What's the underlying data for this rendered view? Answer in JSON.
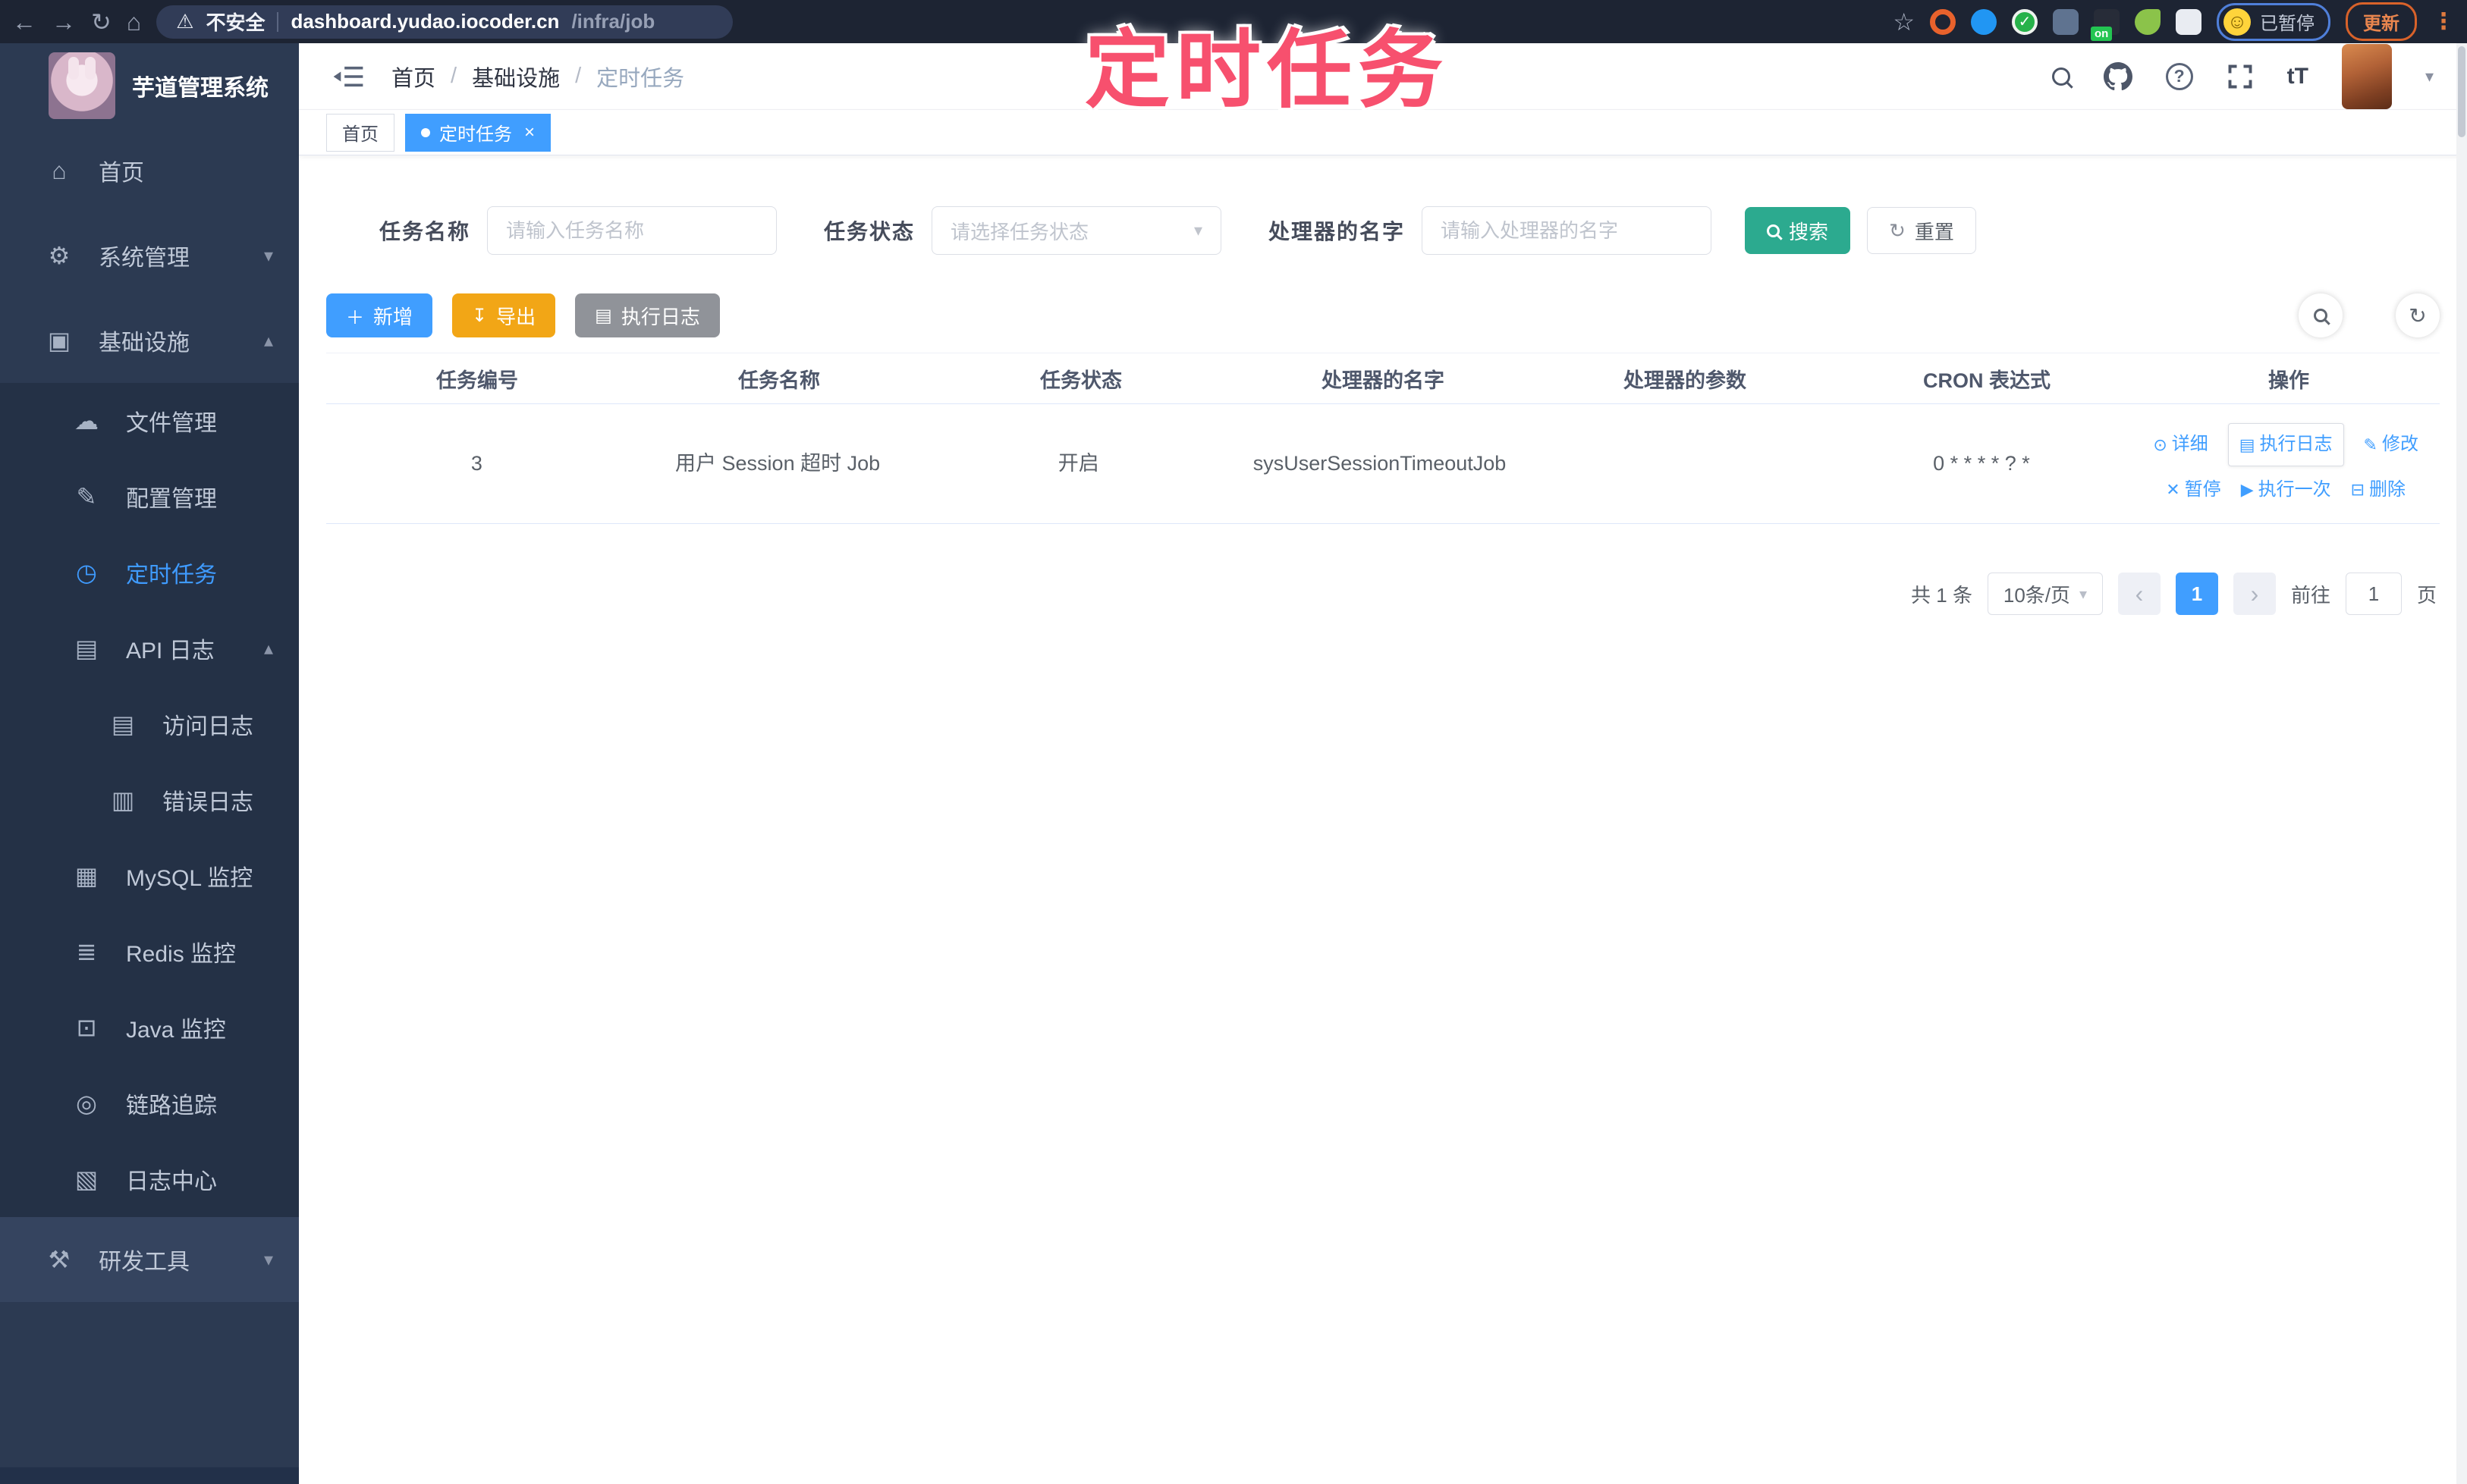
{
  "browser": {
    "security_label": "不安全",
    "url_host": "dashboard.yudao.iocoder.cn",
    "url_path": "/infra/job",
    "on_badge": "on",
    "paused_badge": "已暂停",
    "update_button": "更新"
  },
  "glyphs": {
    "back": "←",
    "forward": "→",
    "reload": "↻",
    "home": "⌂",
    "warning": "⚠",
    "star": "☆",
    "check": "✓",
    "smiley": "☺",
    "menu_dots": "⋮",
    "chevron_down": "▾",
    "chevron_up": "▴",
    "caret": "▾",
    "close": "×",
    "help": "?",
    "font_size": "tT",
    "plus": "＋",
    "download": "↧",
    "list": "▤",
    "refresh": "↻",
    "prev": "‹",
    "next": "›"
  },
  "annotation": {
    "text": "定时任务"
  },
  "sidebar": {
    "title": "芋道管理系统",
    "items": [
      {
        "label": "首页",
        "icon": "⌂"
      },
      {
        "label": "系统管理",
        "icon": "⚙"
      },
      {
        "label": "基础设施",
        "icon": "▣"
      },
      {
        "label": "文件管理",
        "icon": "☁"
      },
      {
        "label": "配置管理",
        "icon": "✎"
      },
      {
        "label": "定时任务",
        "icon": "◷"
      },
      {
        "label": "API 日志",
        "icon": "▤"
      },
      {
        "label": "访问日志",
        "icon": "▤"
      },
      {
        "label": "错误日志",
        "icon": "▥"
      },
      {
        "label": "MySQL 监控",
        "icon": "▦"
      },
      {
        "label": "Redis 监控",
        "icon": "≣"
      },
      {
        "label": "Java 监控",
        "icon": "⊡"
      },
      {
        "label": "链路追踪",
        "icon": "◎"
      },
      {
        "label": "日志中心",
        "icon": "▧"
      },
      {
        "label": "研发工具",
        "icon": "⚒"
      }
    ]
  },
  "header": {
    "breadcrumb": [
      "首页",
      "基础设施",
      "定时任务"
    ],
    "separator": "/"
  },
  "tabs": [
    {
      "label": "首页"
    },
    {
      "label": "定时任务"
    }
  ],
  "filters": {
    "name_label": "任务名称",
    "name_placeholder": "请输入任务名称",
    "status_label": "任务状态",
    "status_placeholder": "请选择任务状态",
    "handler_label": "处理器的名字",
    "handler_placeholder": "请输入处理器的名字",
    "search_button": "搜索",
    "reset_button": "重置"
  },
  "toolbar": {
    "add": "新增",
    "export": "导出",
    "exec_log": "执行日志"
  },
  "table": {
    "columns": [
      "任务编号",
      "任务名称",
      "任务状态",
      "处理器的名字",
      "处理器的参数",
      "CRON 表达式",
      "操作"
    ],
    "row": {
      "id": "3",
      "name": "用户 Session 超时 Job",
      "status": "开启",
      "handler": "sysUserSessionTimeoutJob",
      "params": "",
      "cron": "0 * * * * ? *",
      "actions": [
        {
          "label": "详细",
          "icon": "⊙"
        },
        {
          "label": "执行日志",
          "icon": "▤"
        },
        {
          "label": "修改",
          "icon": "✎"
        },
        {
          "label": "暂停",
          "icon": "✕"
        },
        {
          "label": "执行一次",
          "icon": "▶"
        },
        {
          "label": "删除",
          "icon": "⊟"
        }
      ]
    }
  },
  "pagination": {
    "total": "共 1 条",
    "page_size": "10条/页",
    "page": "1",
    "goto_prefix": "前往",
    "goto_value": "1",
    "goto_suffix": "页"
  },
  "colors": {
    "primary": "#409eff",
    "search_button": "#2caa8f",
    "export_button": "#f2a616",
    "info_button": "#909399",
    "sidebar_bg": "#2c3a52",
    "submenu_bg": "#243146",
    "annotation": "#f7506e"
  }
}
